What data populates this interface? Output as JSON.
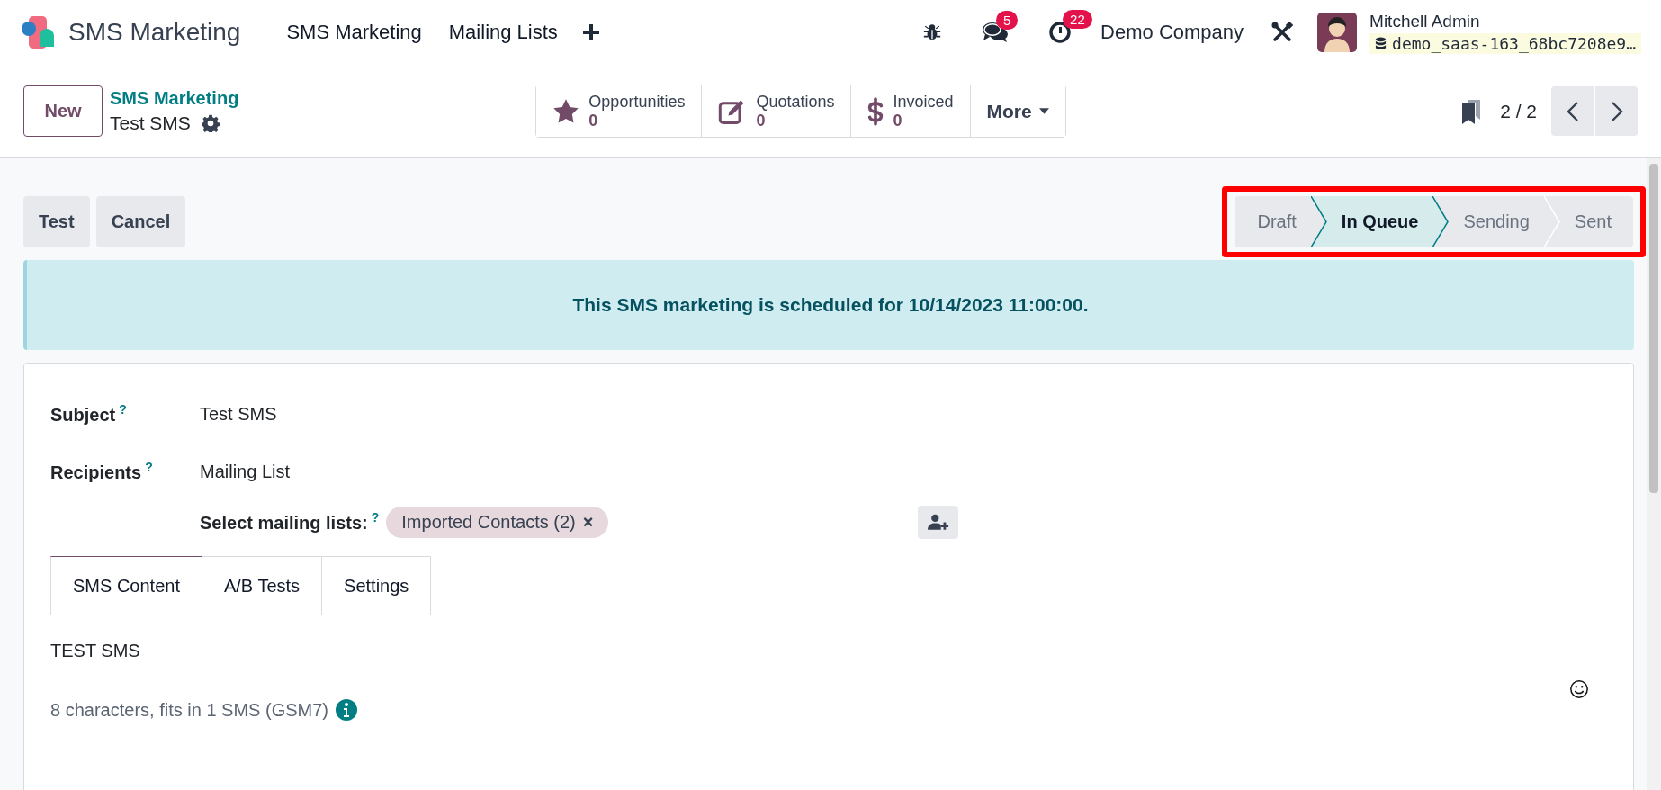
{
  "navbar": {
    "app_name": "SMS Marketing",
    "menus": [
      "SMS Marketing",
      "Mailing Lists"
    ],
    "message_count": "5",
    "activity_count": "22",
    "company": "Demo Company",
    "user": "Mitchell Admin",
    "database": "demo_saas-163_68bc7208e9…"
  },
  "control_panel": {
    "new_button": "New",
    "breadcrumb": "SMS Marketing",
    "record": "Test SMS",
    "smart_buttons": [
      {
        "kind": "star",
        "label": "Opportunities",
        "value": "0"
      },
      {
        "kind": "edit",
        "label": "Quotations",
        "value": "0"
      },
      {
        "kind": "dollar",
        "label": "Invoiced",
        "value": "0"
      }
    ],
    "more": "More",
    "pager": "2 / 2"
  },
  "actions": [
    "Test",
    "Cancel"
  ],
  "statusbar": [
    {
      "label": "Draft",
      "selected": false
    },
    {
      "label": "In Queue",
      "selected": true
    },
    {
      "label": "Sending",
      "selected": false
    },
    {
      "label": "Sent",
      "selected": false
    }
  ],
  "alert": "This SMS marketing is scheduled for 10/14/2023 11:00:00.",
  "form": {
    "fields": [
      {
        "label": "Subject",
        "help": "?",
        "value": "Test SMS"
      },
      {
        "label": "Recipients",
        "help": "?",
        "value": "Mailing List"
      }
    ],
    "mailing_lists": {
      "label": "Select mailing lists:",
      "help": "?",
      "tags": [
        {
          "label": "Imported Contacts (2)",
          "remove": "×"
        }
      ]
    },
    "tabs": [
      {
        "label": "SMS Content",
        "selected": true
      },
      {
        "label": "A/B Tests",
        "selected": false
      },
      {
        "label": "Settings",
        "selected": false
      }
    ],
    "body": "TEST SMS",
    "counter": "8 characters, fits in 1 SMS (GSM7)"
  }
}
